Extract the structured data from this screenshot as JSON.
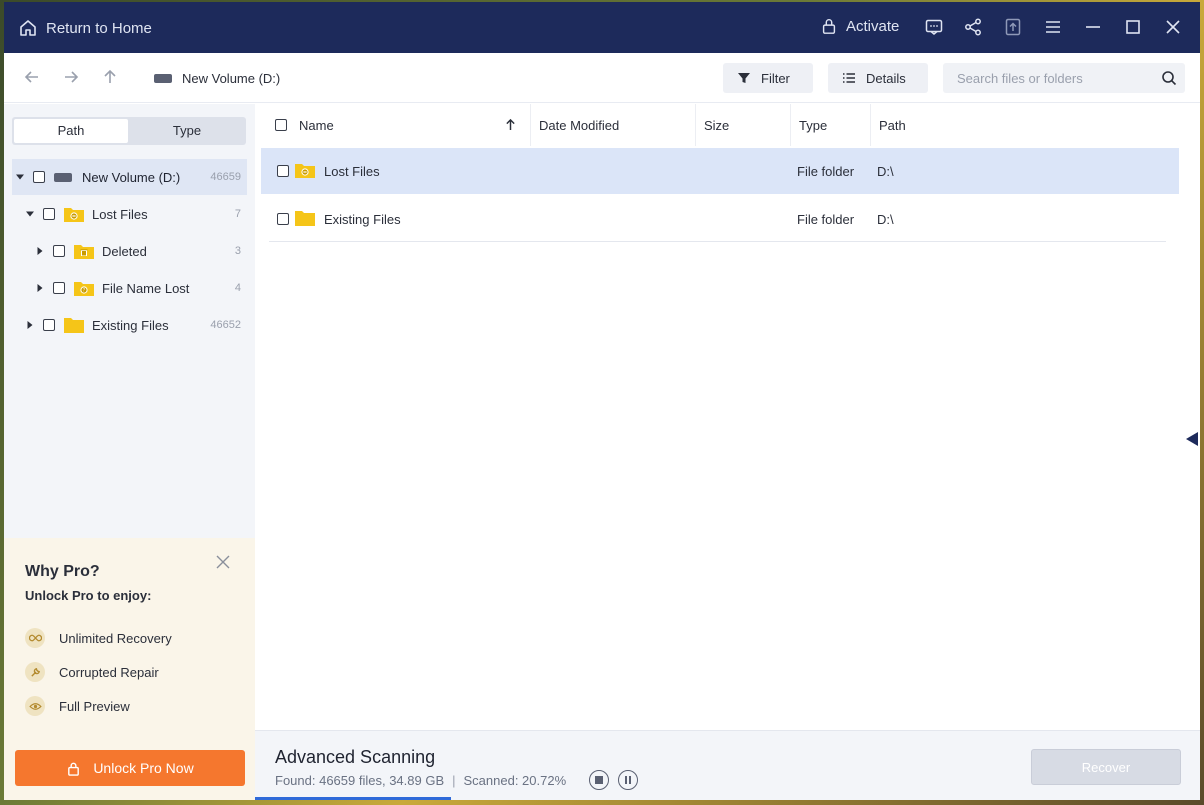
{
  "titlebar": {
    "home_label": "Return to Home",
    "activate_label": "Activate",
    "icons": [
      "feedback-icon",
      "share-icon",
      "upload-icon",
      "menu-icon",
      "minimize-icon",
      "maximize-icon",
      "close-icon"
    ]
  },
  "toolbar": {
    "breadcrumb": "New Volume (D:)",
    "filter_label": "Filter",
    "details_label": "Details",
    "search_placeholder": "Search files or folders"
  },
  "sidebar": {
    "tabs": [
      "Path",
      "Type"
    ],
    "active_tab": "Path",
    "tree": [
      {
        "label": "New Volume (D:)",
        "count": "46659",
        "level": 0,
        "expanded": true,
        "selected": true
      },
      {
        "label": "Lost Files",
        "count": "7",
        "level": 1,
        "expanded": true
      },
      {
        "label": "Deleted",
        "count": "3",
        "level": 2,
        "expanded": false
      },
      {
        "label": "File Name Lost",
        "count": "4",
        "level": 2,
        "expanded": false
      },
      {
        "label": "Existing Files",
        "count": "46652",
        "level": 1,
        "expanded": false
      }
    ]
  },
  "promo": {
    "title": "Why Pro?",
    "subtitle": "Unlock Pro to enjoy:",
    "items": [
      "Unlimited Recovery",
      "Corrupted Repair",
      "Full Preview"
    ],
    "button_label": "Unlock Pro Now"
  },
  "list": {
    "columns": [
      "Name",
      "Date Modified",
      "Size",
      "Type",
      "Path"
    ],
    "sort_column": "Name",
    "sort_direction": "ascending",
    "rows": [
      {
        "name": "Lost Files",
        "date": "",
        "size": "",
        "type": "File folder",
        "path": "D:\\",
        "selected": true
      },
      {
        "name": "Existing Files",
        "date": "",
        "size": "",
        "type": "File folder",
        "path": "D:\\",
        "selected": false
      }
    ]
  },
  "footer": {
    "title": "Advanced Scanning",
    "found": "Found: 46659 files, 34.89 GB",
    "separator": "|",
    "scanned": "Scanned: 20.72%",
    "progress": 0.2072,
    "recover_label": "Recover"
  },
  "colors": {
    "titlebar": "#1d2a5b",
    "accent": "#2f6ad9",
    "promo_button": "#f5772e",
    "folder": "#f5c518",
    "selected_row": "#dbe5f8"
  }
}
